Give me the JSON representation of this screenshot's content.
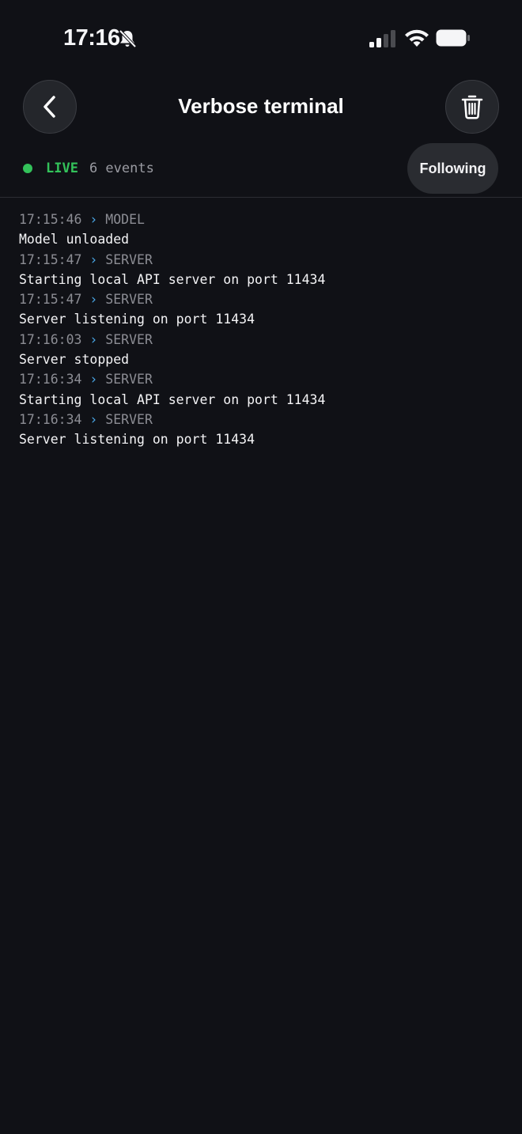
{
  "status_bar": {
    "time": "17:16",
    "icons": [
      "bell-slash-icon",
      "signal-icon",
      "wifi-icon",
      "battery-icon"
    ]
  },
  "header": {
    "title": "Verbose terminal",
    "back_icon": "chevron-left-icon",
    "clear_icon": "trash-icon"
  },
  "live": {
    "label": "LIVE",
    "count": "6 events",
    "follow_label": "Following"
  },
  "colors": {
    "background": "#101116",
    "live_green": "#33c25a",
    "chevron_blue": "#4aa8e8",
    "muted": "#8c8d94"
  },
  "log": [
    {
      "time": "17:15:46",
      "arrow": "›",
      "source": "MODEL",
      "message": "Model unloaded"
    },
    {
      "time": "17:15:47",
      "arrow": "›",
      "source": "SERVER",
      "message": "Starting local API server on port 11434"
    },
    {
      "time": "17:15:47",
      "arrow": "›",
      "source": "SERVER",
      "message": "Server listening on port 11434"
    },
    {
      "time": "17:16:03",
      "arrow": "›",
      "source": "SERVER",
      "message": "Server stopped"
    },
    {
      "time": "17:16:34",
      "arrow": "›",
      "source": "SERVER",
      "message": "Starting local API server on port 11434"
    },
    {
      "time": "17:16:34",
      "arrow": "›",
      "source": "SERVER",
      "message": "Server listening on port 11434"
    }
  ]
}
